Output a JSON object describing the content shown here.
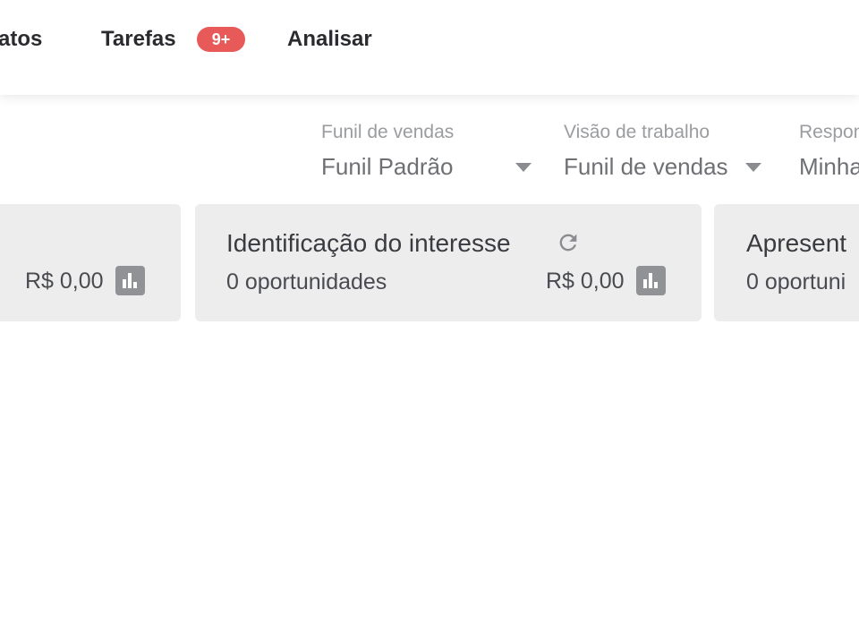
{
  "nav": {
    "item_contatos": "atos",
    "item_tarefas": "Tarefas",
    "tarefas_badge": "9+",
    "item_analisar": "Analisar"
  },
  "filters": [
    {
      "label": "Funil de vendas",
      "value": "Funil Padrão"
    },
    {
      "label": "Visão de trabalho",
      "value": "Funil de vendas"
    },
    {
      "label": "Respon",
      "value": "Minha"
    }
  ],
  "stages": [
    {
      "title": "",
      "count": "",
      "amount": "R$ 0,00"
    },
    {
      "title": "Identificação do interesse",
      "count": "0 oportunidades",
      "amount": "R$ 0,00"
    },
    {
      "title": "Apresent",
      "count": "0 oportuni",
      "amount": ""
    }
  ],
  "icons": {
    "chart": "bar-chart-icon",
    "refresh": "refresh-icon",
    "caret": "chevron-down-icon"
  },
  "colors": {
    "badge": "#e85a5a",
    "card_bg": "#ededed",
    "icon_bg": "#909296",
    "text_dark": "#2b2b2f",
    "text_muted": "#9a9ca0"
  }
}
